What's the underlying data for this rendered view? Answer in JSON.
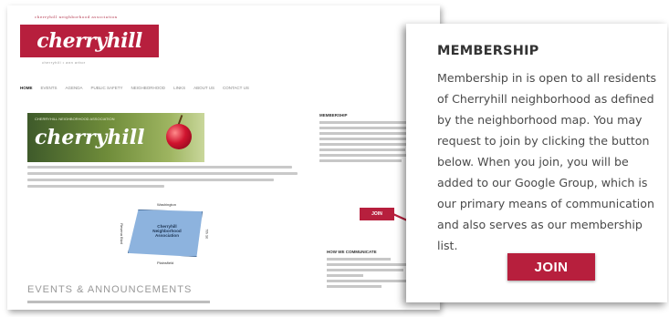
{
  "site": {
    "tagline_top": "cherryhill neighborhood association",
    "logo_text": "cherryhill",
    "tagline_bottom": "cherryhill • ann arbor",
    "nav": [
      "Home",
      "Events",
      "Agenda",
      "Public Safety",
      "Neighborhood",
      "Links",
      "About Us",
      "Contact Us"
    ],
    "banner_small": "CHERRYHILL NEIGHBORHOOD ASSOCIATION",
    "banner_name": "cherryhill",
    "map": {
      "north": "Washington",
      "south": "Plainsfield",
      "west": "Revena Blvd",
      "east": "7th St",
      "center": "Cherryhill Neighborhood Association"
    },
    "events_heading": "EVENTS & ANNOUNCEMENTS",
    "side_heading": "MEMBERSHIP",
    "side_join": "JOIN",
    "side_heading_2": "HOW WE COMMUNICATE"
  },
  "callout": {
    "title": "MEMBERSHIP",
    "body": "Membership in is open to all residents of  Cherryhill neighborhood as defined by the neighborhood map. You may request to join by clicking the button below. When you join, you will be added to our Google Group, which is our primary means of communication and also serves as our membership list.",
    "join_label": "JOIN"
  },
  "colors": {
    "brand": "#b71f3d",
    "connector": "#b71f3d"
  }
}
